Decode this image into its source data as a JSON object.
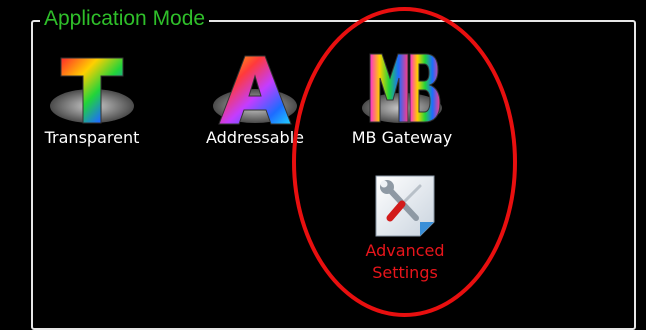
{
  "group": {
    "title": "Application Mode"
  },
  "modes": [
    {
      "label": "Transparent",
      "icon": "transparent-t-icon"
    },
    {
      "label": "Addressable",
      "icon": "addressable-a-icon"
    },
    {
      "label": "MB Gateway",
      "icon": "mb-gateway-icon"
    },
    {
      "label_line1": "Advanced",
      "label_line2": "Settings",
      "icon": "tools-settings-icon"
    }
  ],
  "colors": {
    "background": "#000000",
    "group_title": "#2fbf2a",
    "advanced_label": "#e8151b",
    "highlight_circle": "#e80f0f"
  }
}
